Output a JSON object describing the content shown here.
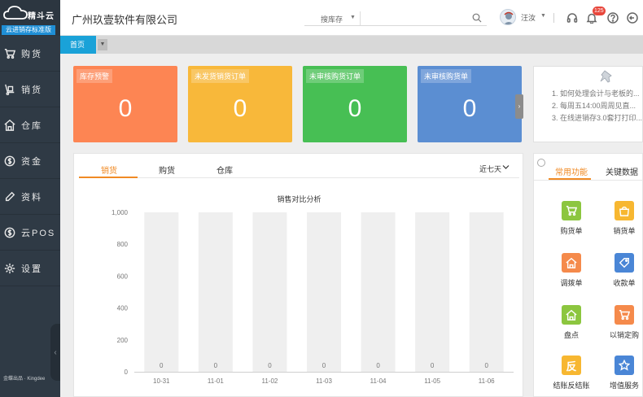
{
  "brand": {
    "name": "精斗云",
    "edition": "云进销存标准版",
    "footer": "金蝶出品 · Kingdee"
  },
  "sidebar": {
    "items": [
      {
        "label": "购货",
        "icon": "cart-icon"
      },
      {
        "label": "销货",
        "icon": "handtruck-icon"
      },
      {
        "label": "仓库",
        "icon": "warehouse-icon"
      },
      {
        "label": "资金",
        "icon": "money-icon"
      },
      {
        "label": "资料",
        "icon": "pen-icon"
      },
      {
        "label": "云POS",
        "icon": "cloud-pos-icon"
      },
      {
        "label": "设置",
        "icon": "gear-icon"
      }
    ],
    "collapse": "‹"
  },
  "header": {
    "company": "广州玖壹软件有限公司",
    "search_scope": "搜库存",
    "search_placeholder": "",
    "user": "汪汝",
    "notifications": "125"
  },
  "tabbar": {
    "home": "首页"
  },
  "cards": [
    {
      "title": "库存预警",
      "value": "0",
      "color": "#fd8553"
    },
    {
      "title": "未发货销货订单",
      "value": "0",
      "color": "#f8b83a"
    },
    {
      "title": "未审核购货订单",
      "value": "0",
      "color": "#47bf54"
    },
    {
      "title": "未审核购货单",
      "value": "0",
      "color": "#5b8ed2"
    }
  ],
  "notice": {
    "items": [
      "1. 如何处理会计与老板的...",
      "2. 每周五14:00周周见直...",
      "3. 在线进销存3.0套打打印..."
    ]
  },
  "main": {
    "tabs": [
      "销货",
      "购货",
      "仓库"
    ],
    "active_tab": 0,
    "range": "近七天"
  },
  "chart_data": {
    "type": "bar",
    "title": "销售对比分析",
    "categories": [
      "10-31",
      "11-01",
      "11-02",
      "11-03",
      "11-04",
      "11-05",
      "11-06"
    ],
    "values": [
      0,
      0,
      0,
      0,
      0,
      0,
      0
    ],
    "ylim": [
      0,
      1000
    ],
    "yticks": [
      "1,000",
      "800",
      "600",
      "400",
      "200",
      "0"
    ],
    "bar_color": "#efefef",
    "grid": false
  },
  "right_panel": {
    "tabs": [
      "常用功能",
      "关键数据"
    ],
    "shortcuts": [
      {
        "label": "购货单",
        "color": "#8cc63f",
        "icon": "cart-icon"
      },
      {
        "label": "销货单",
        "color": "#f7b731",
        "icon": "bag-icon"
      },
      {
        "label": "调拨单",
        "color": "#f58a4b",
        "icon": "house-icon"
      },
      {
        "label": "收款单",
        "color": "#4a86d6",
        "icon": "tag-icon"
      },
      {
        "label": "盘点",
        "color": "#8cc63f",
        "icon": "house-icon"
      },
      {
        "label": "以销定购",
        "color": "#f58a4b",
        "icon": "cart-icon"
      },
      {
        "label": "结账反结账",
        "color": "#f7b731",
        "glyph": "反"
      },
      {
        "label": "增值服务",
        "color": "#4a86d6",
        "icon": "star-icon"
      }
    ]
  }
}
